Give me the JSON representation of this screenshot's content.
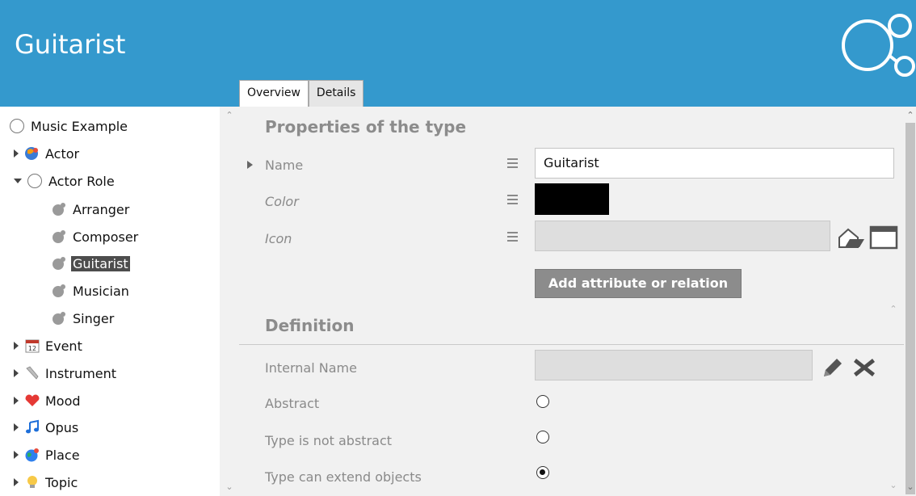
{
  "header": {
    "title": "Guitarist",
    "logo_icon": "graph-nodes-icon",
    "bg_color": "#3499cd"
  },
  "tabs": [
    {
      "label": "Overview",
      "active": true
    },
    {
      "label": "Details",
      "active": false
    }
  ],
  "tree": {
    "root": "Music Example",
    "items": [
      {
        "label": "Actor",
        "icon": "actor-icon"
      },
      {
        "label": "Actor Role",
        "icon": "circle-icon",
        "expanded": true,
        "children": [
          "Arranger",
          "Composer",
          "Guitarist",
          "Musician",
          "Singer"
        ]
      },
      {
        "label": "Event",
        "icon": "calendar-icon"
      },
      {
        "label": "Instrument",
        "icon": "wrench-icon"
      },
      {
        "label": "Mood",
        "icon": "heart-icon"
      },
      {
        "label": "Opus",
        "icon": "music-note-icon"
      },
      {
        "label": "Place",
        "icon": "globe-icon"
      },
      {
        "label": "Topic",
        "icon": "lightbulb-icon"
      }
    ],
    "selected": "Guitarist"
  },
  "properties": {
    "section_title": "Properties of the type",
    "name_label": "Name",
    "name_value": "Guitarist",
    "color_label": "Color",
    "color_value": "#000000",
    "icon_label": "Icon",
    "icon_value": "",
    "add_button": "Add attribute or relation"
  },
  "definition": {
    "section_title": "Definition",
    "internal_name_label": "Internal Name",
    "internal_name_value": "",
    "options": [
      {
        "label": "Abstract",
        "checked": false
      },
      {
        "label": "Type is not abstract",
        "checked": false
      },
      {
        "label": "Type can extend objects",
        "checked": true
      }
    ]
  }
}
